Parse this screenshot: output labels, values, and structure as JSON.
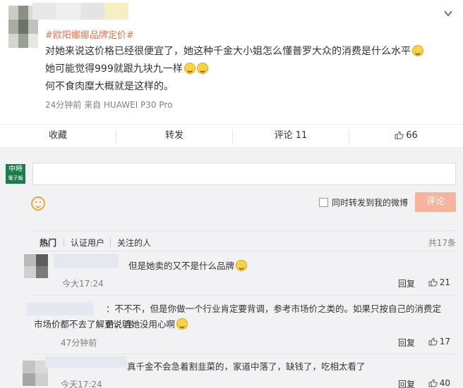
{
  "post": {
    "topic": "#欧阳娜娜品牌定价#",
    "lines": [
      "对她来说这价格已经很便宜了，她这种千金大小姐怎么懂普罗大众的消费是什么水平",
      "她可能觉得999就跟九块九一样",
      "何不食肉糜大概就是这样的。"
    ],
    "meta": "24分钟前  来自 HUAWEI P30 Pro"
  },
  "actions": {
    "collect": "收藏",
    "forward": "转发",
    "comment": "评论 11",
    "like": "66"
  },
  "composer": {
    "logo_top": "中時",
    "logo_bottom": "電子報",
    "forward_label": "同时转发到我的微博",
    "submit": "评论"
  },
  "filters": {
    "hot": "热门",
    "verified": "认证用户",
    "following": "关注的人",
    "total": "共17条"
  },
  "comments": [
    {
      "text": "但是她卖的又不是什么品牌",
      "time": "今大17:24",
      "reply": "回复",
      "likes": "21"
    },
    {
      "text": "：不不不，但是你做一个行业肯定要背调，参考市场价之类的。如果只按自己的消费定价，连",
      "text2": "市场价都不去了解更说明她没用心啊",
      "time": "47分钟前",
      "reply": "回复",
      "likes": "17"
    },
    {
      "text": "真千金不会急着割韭菜的，家道中落了，缺钱了，吃相太看了",
      "time": "今天17:24",
      "reply": "回复",
      "likes": "40"
    }
  ],
  "colors": {
    "accent": "#eb7350",
    "submit": "#f7b49d",
    "bg": "#f2f2f5"
  },
  "icons": [
    "chevron-down-icon",
    "smiley-icon",
    "thumb-up-icon",
    "emoji-icon"
  ]
}
